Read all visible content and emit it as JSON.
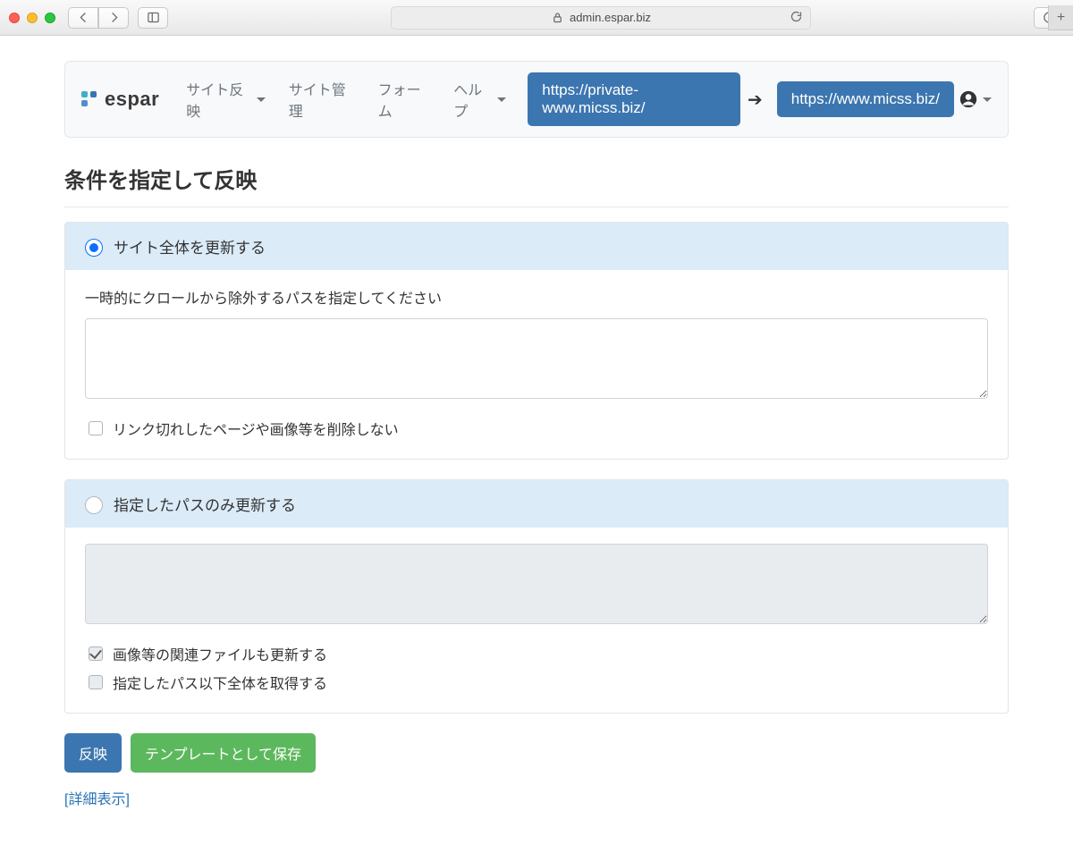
{
  "browser": {
    "domain": "admin.espar.biz"
  },
  "nav": {
    "brand": "espar",
    "items": [
      {
        "label": "サイト反映",
        "has_menu": true
      },
      {
        "label": "サイト管理",
        "has_menu": false
      },
      {
        "label": "フォーム",
        "has_menu": false
      },
      {
        "label": "ヘルプ",
        "has_menu": true
      }
    ],
    "source_url": "https://private-www.micss.biz/",
    "target_url": "https://www.micss.biz/"
  },
  "page": {
    "title": "条件を指定して反映"
  },
  "section_full": {
    "radio_label": "サイト全体を更新する",
    "excludes_label": "一時的にクロールから除外するパスを指定してください",
    "excludes_value": "",
    "no_delete_label": "リンク切れしたページや画像等を削除しない",
    "no_delete_checked": false,
    "selected": true
  },
  "section_paths": {
    "radio_label": "指定したパスのみ更新する",
    "paths_value": "",
    "related_label": "画像等の関連ファイルも更新する",
    "related_checked": true,
    "recurse_label": "指定したパス以下全体を取得する",
    "recurse_checked": false,
    "selected": false
  },
  "actions": {
    "apply": "反映",
    "save_template": "テンプレートとして保存",
    "advanced": "[詳細表示]"
  }
}
